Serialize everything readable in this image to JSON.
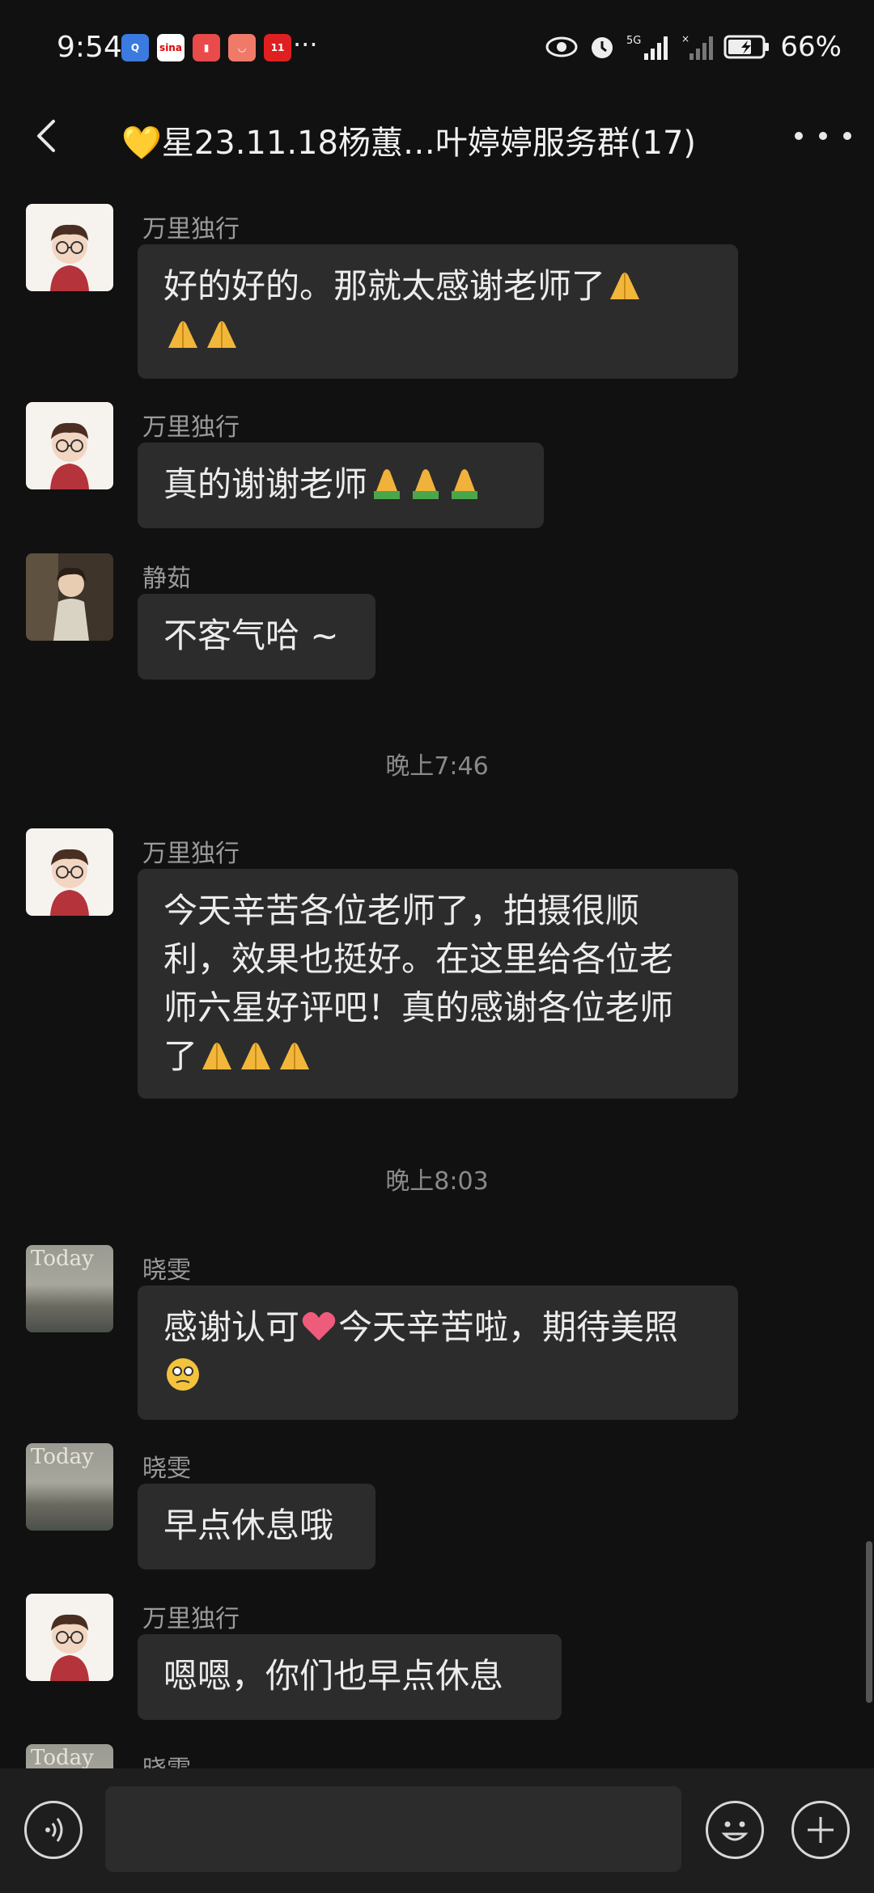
{
  "status_bar": {
    "time": "9:54",
    "more": "···",
    "battery": "66%",
    "network": "5G"
  },
  "header": {
    "title": "💛星23.11.18杨蕙…叶婷婷服务群(17)"
  },
  "messages": [
    {
      "sender": "万里独行",
      "line1": "好的好的。那就太感谢老师了",
      "avatar": "man-glasses"
    },
    {
      "sender": "万里独行",
      "line1": "真的谢谢老师",
      "avatar": "man-glasses"
    },
    {
      "sender": "静茹",
      "line1": "不客气哈 ~",
      "avatar": "girl-photo"
    },
    {
      "sender": "万里独行",
      "lines": [
        "今天辛苦各位老师了，拍摄很顺",
        "利，效果也挺好。在这里给各位老",
        "师六星好评吧！真的感谢各位老师",
        "了"
      ],
      "avatar": "man-glasses"
    },
    {
      "sender": "晓雯",
      "line1": "感谢认可",
      "line1b": "今天辛苦啦，期待美照",
      "avatar": "today-landscape"
    },
    {
      "sender": "晓雯",
      "line1": "早点休息哦",
      "avatar": "today-landscape"
    },
    {
      "sender": "万里独行",
      "line1": "嗯嗯，你们也早点休息",
      "avatar": "man-glasses"
    },
    {
      "sender": "晓雯",
      "avatar": "today-landscape"
    }
  ],
  "time_dividers": [
    "晚上7:46",
    "晚上8:03"
  ],
  "avatar_text": "Today",
  "colors": {
    "background": "#111111",
    "bubble": "#2c2c2c",
    "sender": "#9a9a9a"
  }
}
